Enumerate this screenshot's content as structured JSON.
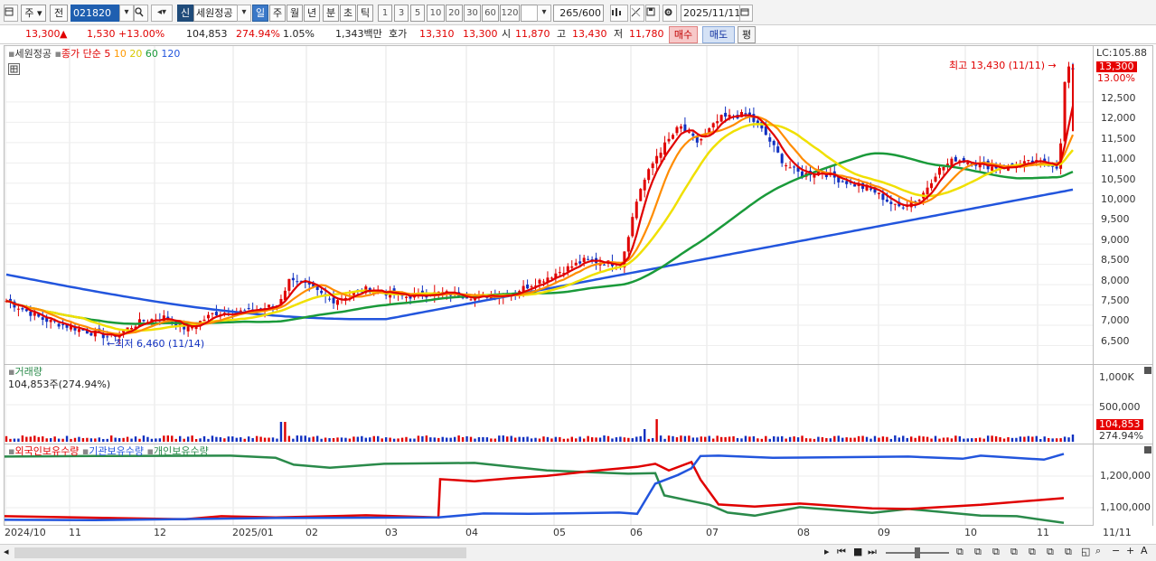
{
  "toolbar": {
    "type_label": "주",
    "prefix_label": "전",
    "code": "021820",
    "credit_tag": "신",
    "stock_name": "세원정공",
    "periods": [
      "일",
      "주",
      "월",
      "년",
      "분",
      "초",
      "틱"
    ],
    "active_period": "일",
    "intervals": [
      "1",
      "3",
      "5",
      "10",
      "20",
      "30",
      "60",
      "120"
    ],
    "count": "265",
    "count_max": "/600",
    "date": "2025/11/11"
  },
  "quote": {
    "price": "13,300",
    "arrow": "▲",
    "change": "1,530",
    "change_pct": "+13.00%",
    "volume": "104,853",
    "volume_ratio": "274.94%",
    "turnover": "1.05%",
    "amount": "1,343백만",
    "bid_label": "호가",
    "bid1": "13,310",
    "bid2": "13,300",
    "open_label": "시",
    "open": "11,870",
    "high_label": "고",
    "high": "13,430",
    "low_label": "저",
    "low": "11,780",
    "buy_label": "매수",
    "sell_label": "매도",
    "avg_label": "평"
  },
  "price_panel": {
    "name": "세원정공",
    "ma_title": "종가 단순",
    "ma_periods": [
      {
        "label": "5",
        "color": "#e00000"
      },
      {
        "label": "10",
        "color": "#ff8c00"
      },
      {
        "label": "20",
        "color": "#f0e000"
      },
      {
        "label": "60",
        "color": "#1a9a3a"
      },
      {
        "label": "120",
        "color": "#2255dd"
      }
    ],
    "high_annotation": "최고 13,430 (11/11)",
    "low_annotation": "최저 6,460 (11/14)",
    "axis_top": "LC:105.88",
    "price_tag": "13,300",
    "pct_tag": "13.00%",
    "y_ticks": [
      "12,500",
      "12,000",
      "11,500",
      "11,000",
      "10,500",
      "10,000",
      "9,500",
      "9,000",
      "8,500",
      "8,000",
      "7,500",
      "7,000",
      "6,500"
    ]
  },
  "volume_panel": {
    "title": "거래량",
    "value_label": "104,853주(274.94%)",
    "y_ticks": [
      "1,000K",
      "500,000"
    ],
    "value_tag": "104,853",
    "pct_tag": "274.94%"
  },
  "holdings_panel": {
    "series": [
      {
        "label": "외국인보유수량",
        "color": "#e00000"
      },
      {
        "label": "기관보유수량",
        "color": "#2255dd"
      },
      {
        "label": "개인보유수량",
        "color": "#2a8a4a"
      }
    ],
    "y_ticks": [
      "1,200,000",
      "1,100,000"
    ]
  },
  "x_axis": {
    "labels": [
      "2024/10",
      "11",
      "12",
      "2025/01",
      "02",
      "03",
      "04",
      "05",
      "06",
      "07",
      "08",
      "09",
      "10",
      "11"
    ],
    "right_label": "11/11"
  },
  "colors": {
    "up": "#e00000",
    "down": "#1030c0",
    "ma5": "#e00000",
    "ma10": "#ff8c00",
    "ma20": "#f0e000",
    "ma60": "#1a9a3a",
    "ma120": "#2255dd"
  }
}
